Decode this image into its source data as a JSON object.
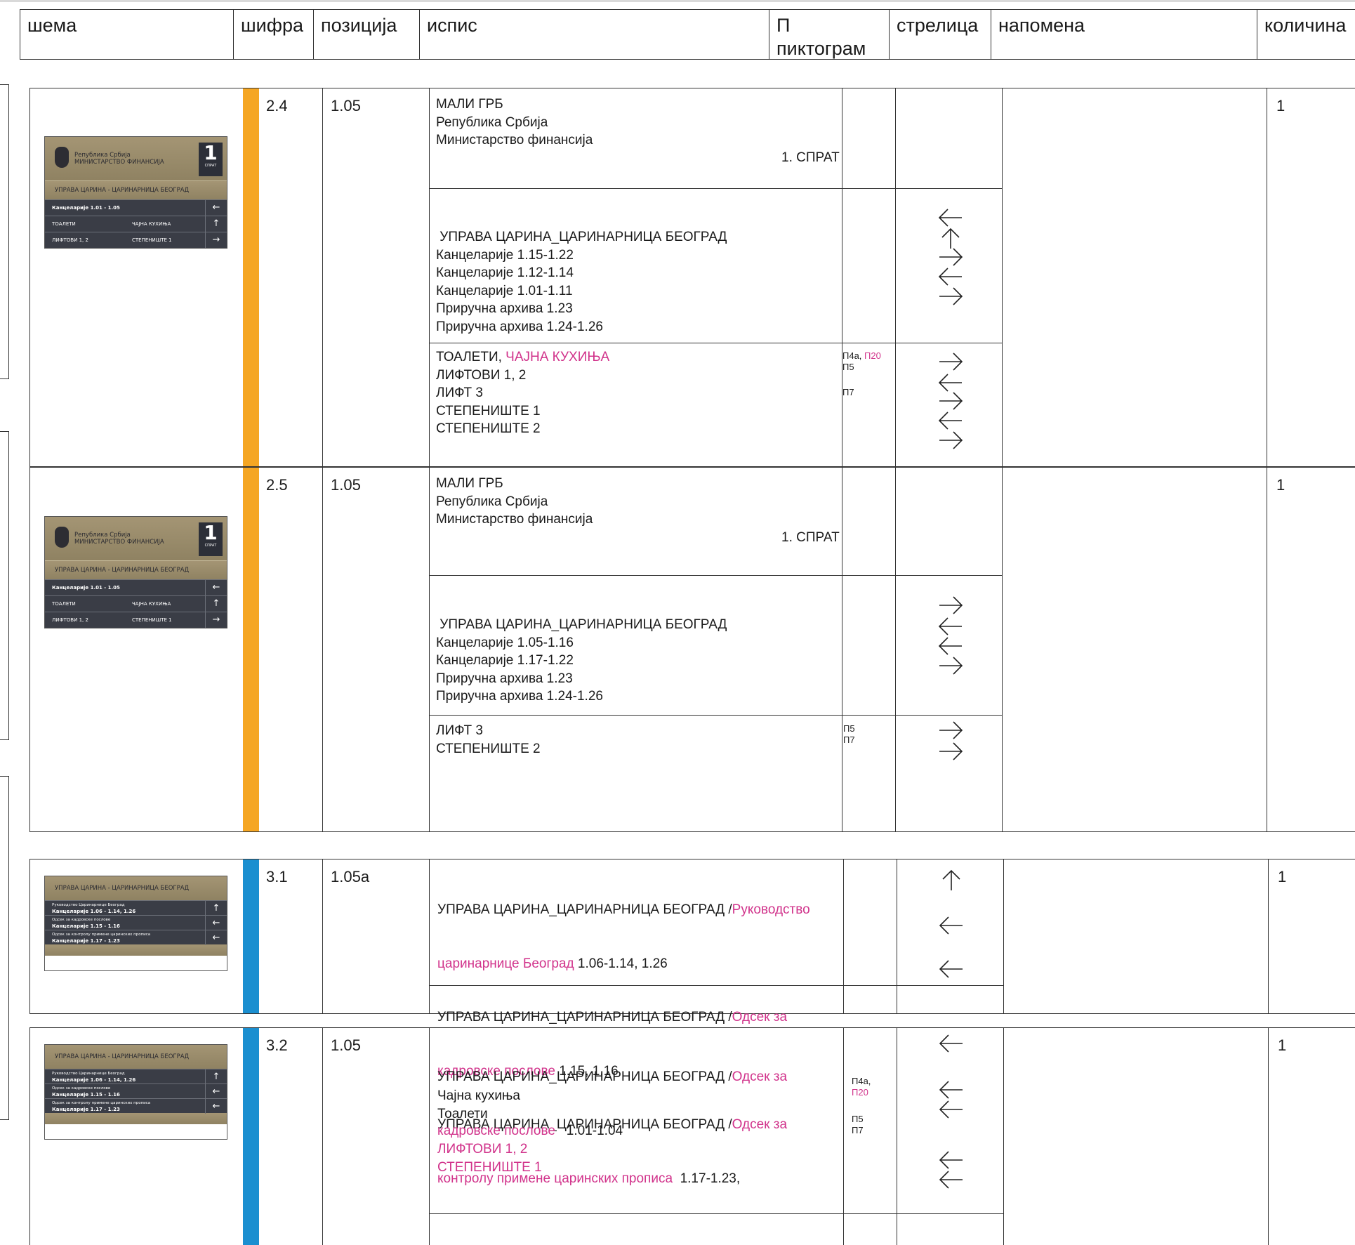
{
  "header": {
    "schema": "шема",
    "code": "шифра",
    "position": "позиција",
    "text": "испис",
    "pictogram": "П\nпиктограм",
    "arrow": "стрелица",
    "note": "напомена",
    "quantity": "количина"
  },
  "sign_a": {
    "republic": "Република Србија",
    "ministry": "МИНИСТАРСТВО ФИНАНСИЈА",
    "floor_num": "1",
    "floor_label": "СПРАТ",
    "uprava": "УПРАВА ЦАРИНА - ЦАРИНАРНИЦА БЕОГРАД",
    "offices": "Канцеларије 1.01 - 1.05",
    "toilets": "ТОАЛЕТИ",
    "kitchen": "ЧАЈНА КУХИЊА",
    "lifts": "ЛИФТОВИ 1, 2",
    "stairs": "СТЕПЕНИШТЕ 1",
    "arrows": [
      "←",
      "↑",
      "→"
    ]
  },
  "sign_b": {
    "uprava": "УПРАВА ЦАРИНА - ЦАРИНАРНИЦА БЕОГРАД",
    "r1_small": "Руководство Царинарнице Београд",
    "r1_big": "Канцеларије 1.06 - 1.14, 1.26",
    "r2_small": "Одсек за кадровске послове",
    "r2_big": "Канцеларије 1.15 - 1.16",
    "r3_small": "Одсек за контролу примене царинских прописа",
    "r3_big": "Канцеларије 1.17 - 1.23",
    "arrows": [
      "↑",
      "←",
      "←"
    ]
  },
  "rows": {
    "r1": {
      "code": "2.4",
      "position": "1.05",
      "quantity": "1",
      "top_lines": [
        "МАЛИ ГРБ",
        "Република Србија",
        "Министарство финансија"
      ],
      "floor": "1. СПРАТ",
      "mid_lines": [
        " УПРАВА ЦАРИНА_ЦАРИНАРНИЦА БЕОГРАД",
        "Канцеларије 1.15-1.22",
        "Канцеларије 1.12-1.14",
        "Канцеларије 1.01-1.11",
        "Приручна архива 1.23",
        "Приручна архива 1.24-1.26"
      ],
      "bot_first": "ТОАЛЕТИ, ",
      "bot_first_pink": "ЧАЈНА КУХИЊА",
      "bot_lines": [
        "ЛИФТОВИ 1, 2",
        "ЛИФТ 3",
        "СТЕПЕНИШТЕ 1",
        "СТЕПЕНИШТЕ 2"
      ],
      "picto_1": "П4а, ",
      "picto_1_pink": "П20",
      "picto_2": "П5",
      "picto_3": "П7"
    },
    "r2": {
      "code": "2.5",
      "position": "1.05",
      "quantity": "1",
      "top_lines": [
        "МАЛИ ГРБ",
        "Република Србија",
        "Министарство финансија"
      ],
      "floor": "1. СПРАТ",
      "mid_lines": [
        " УПРАВА ЦАРИНА_ЦАРИНАРНИЦА БЕОГРАД",
        "Канцеларије 1.05-1.16",
        "Канцеларије 1.17-1.22",
        "Приручна архива 1.23",
        "Приручна архива 1.24-1.26"
      ],
      "bot_lines": [
        "ЛИФТ 3",
        "СТЕПЕНИШТЕ 2"
      ],
      "picto_1": "П5",
      "picto_2": "П7"
    },
    "r3": {
      "code": "3.1",
      "position": "1.05a",
      "quantity": "1",
      "l1a": "УПРАВА ЦАРИНА_ЦАРИНАРНИЦА БЕОГРАД /",
      "l1b": "Руководство",
      "l2a": "царинарнице Београд",
      "l2b": " 1.06-1.14, 1.26",
      "l3a": "УПРАВА ЦАРИНА_ЦАРИНАРНИЦА БЕОГРАД /",
      "l3b": "Одсек за",
      "l4a": "кадровске послове",
      "l4b": " 1.15, 1.16",
      "l5a": "УПРАВА ЦАРИНА_ЦАРИНАРНИЦА БЕОГРАД /",
      "l5b": "Одсек за",
      "l6a": "контролу примене царинских прописа",
      "l6b": "  1.17-1.23,"
    },
    "r4": {
      "code": "3.2",
      "position": "1.05",
      "quantity": "1",
      "l1a": "УПРАВА ЦАРИНА_ЦАРИНАРНИЦА БЕОГРАД /",
      "l1b": "Одсек за",
      "l2a": "кадровске послове",
      "l2b": "   1.01-1.04",
      "kitchen": "Чајна кухиња",
      "toilets": "Тоалети",
      "lifts": "ЛИФТОВИ 1, 2",
      "stairs": "СТЕПЕНИШТЕ 1",
      "picto_1": "П4а,",
      "picto_1_pink": "П20",
      "picto_2": "П5",
      "picto_3": "П7"
    }
  },
  "colors": {
    "orange": "#f5a623",
    "blue": "#1b8fd0",
    "pink": "#d1338b"
  }
}
